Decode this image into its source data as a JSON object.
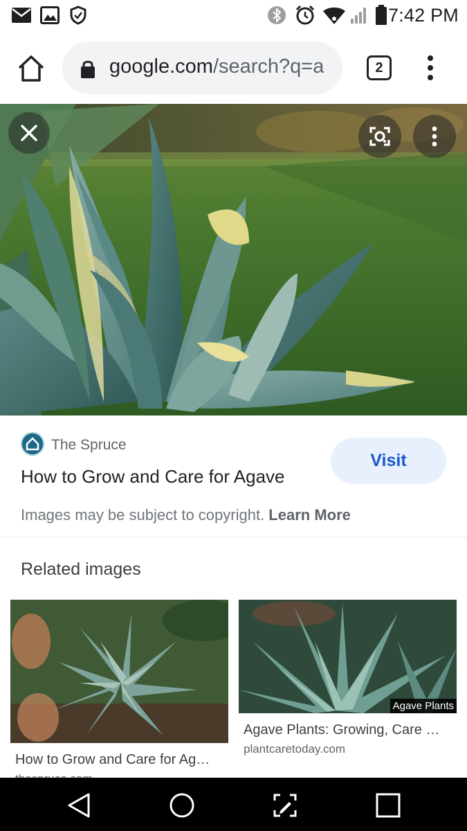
{
  "status_bar": {
    "time": "7:42 PM",
    "left_icons": [
      "mail-icon",
      "image-icon",
      "shield-icon"
    ],
    "right_icons": [
      "bluetooth-icon",
      "alarm-icon",
      "wifi-icon",
      "signal-icon",
      "battery-icon"
    ]
  },
  "browser": {
    "url_host": "google.com",
    "url_path": "/search?q=a",
    "tab_count": "2"
  },
  "result": {
    "source_name": "The Spruce",
    "title": "How to Grow and Care for Agave",
    "visit_label": "Visit",
    "copyright_text": "Images may be subject to copyright.",
    "learn_more_label": "Learn More"
  },
  "related": {
    "heading": "Related images",
    "items": [
      {
        "title": "How to Grow and Care for Ag…",
        "domain": "thespruce.com"
      },
      {
        "title": "Agave Plants: Growing, Care …",
        "domain": "plantcaretoday.com",
        "thumb_caption": "Agave Plants"
      }
    ]
  },
  "nav_bar": {
    "buttons": [
      "back-icon",
      "home-icon",
      "screen-capture-icon",
      "recents-icon"
    ]
  },
  "colors": {
    "accent": "#1a57c8",
    "visit_bg": "#e8f0fe",
    "source_icon": "#1b6a86"
  }
}
